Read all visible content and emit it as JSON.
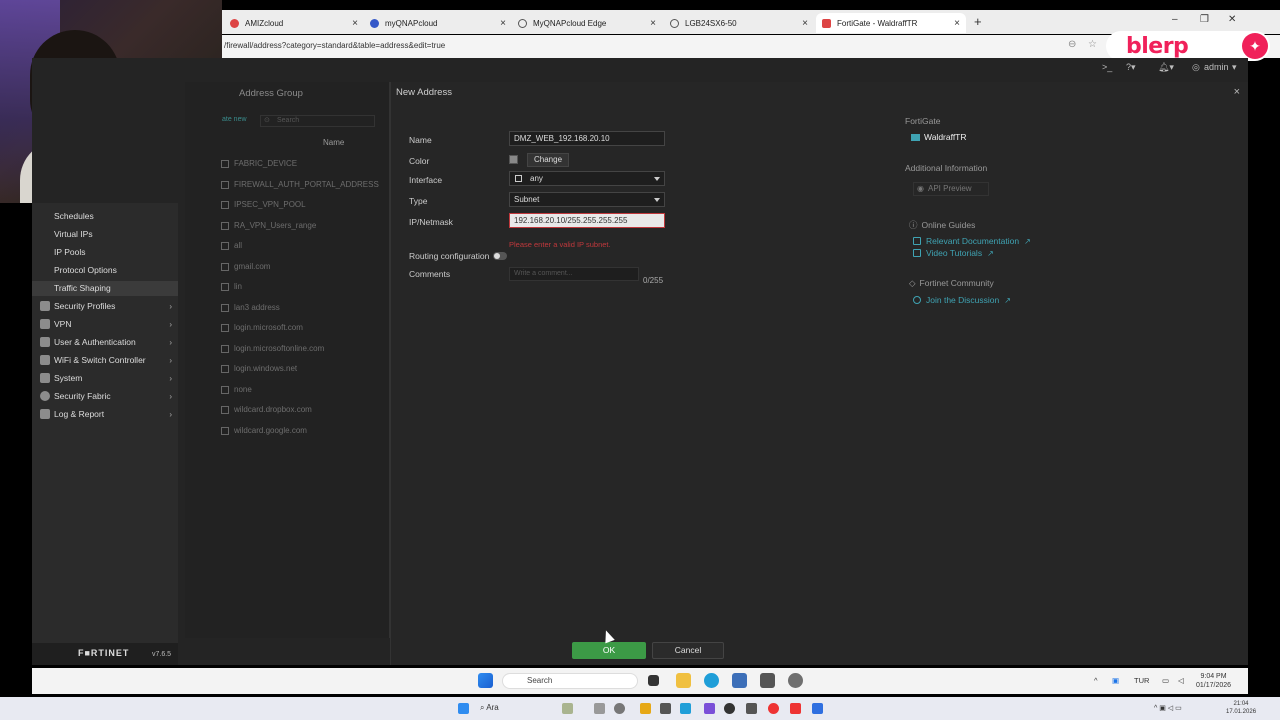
{
  "browser": {
    "tabs": [
      {
        "label": "AMIZcloud",
        "icon_color": "#d44"
      },
      {
        "label": "myQNAPcloud",
        "icon_color": "#3558c8"
      },
      {
        "label": "MyQNAPcloud Edge",
        "icon_color": "#555"
      },
      {
        "label": "LGB24SX6-50",
        "icon_color": "#555"
      },
      {
        "label": "FortiGate - WaldraffTR",
        "icon_color": "#d44"
      }
    ],
    "url": "/firewall/address?category=standard&table=address&edit=true",
    "overlay_logo": "blerp"
  },
  "topbar": {
    "admin_label": "admin"
  },
  "sidebar": {
    "subitems": [
      "Schedules",
      "Virtual IPs",
      "IP Pools",
      "Protocol Options",
      "Traffic Shaping"
    ],
    "main_items": [
      "Security Profiles",
      "VPN",
      "User & Authentication",
      "WiFi & Switch Controller",
      "System",
      "Security Fabric",
      "Log & Report"
    ],
    "brand": "F■RTINET",
    "version": "v7.6.5"
  },
  "list": {
    "title": "Address Group",
    "create_new": "ate new",
    "search_placeholder": "Search",
    "column_name": "Name",
    "items": [
      "FABRIC_DEVICE",
      "FIREWALL_AUTH_PORTAL_ADDRESS",
      "IPSEC_VPN_POOL",
      "RA_VPN_Users_range",
      "all",
      "gmail.com",
      "lin",
      "lan3 address",
      "login.microsoft.com",
      "login.microsoftonline.com",
      "login.windows.net",
      "none",
      "wildcard.dropbox.com",
      "wildcard.google.com"
    ]
  },
  "dialog": {
    "title": "New Address",
    "labels": {
      "name": "Name",
      "color": "Color",
      "interface": "Interface",
      "type": "Type",
      "ipnetmask": "IP/Netmask",
      "routing": "Routing configuration",
      "comments": "Comments"
    },
    "name_value": "DMZ_WEB_192.168.20.10",
    "color_button": "Change",
    "interface_value": "any",
    "type_value": "Subnet",
    "ipnetmask_value": "192.168.20.10/255.255.255.255",
    "error_message": "Please enter a valid IP subnet.",
    "comments_placeholder": "Write a comment...",
    "char_count": "0/255",
    "ok": "OK",
    "cancel": "Cancel"
  },
  "info_panel": {
    "fortigate_head": "FortiGate",
    "fortigate_name": "WaldraffTR",
    "additional_head": "Additional Information",
    "api_preview": "API Preview",
    "guides_head": "Online Guides",
    "doc_link": "Relevant Documentation",
    "video_link": "Video Tutorials",
    "community_head": "Fortinet Community",
    "discussion_link": "Join the Discussion"
  },
  "taskbar": {
    "search_placeholder": "Search",
    "tray_lang": "TUR",
    "time": "9:04 PM",
    "date": "01/17/2026"
  },
  "host": {
    "search_label": "Ara",
    "time": "21:04",
    "date": "17.01.2026"
  },
  "colors": {
    "accent_green": "#3c9a46",
    "link_teal": "#3fa3b3",
    "error_red": "#c0383c",
    "blerp_pink": "#f0215a"
  }
}
